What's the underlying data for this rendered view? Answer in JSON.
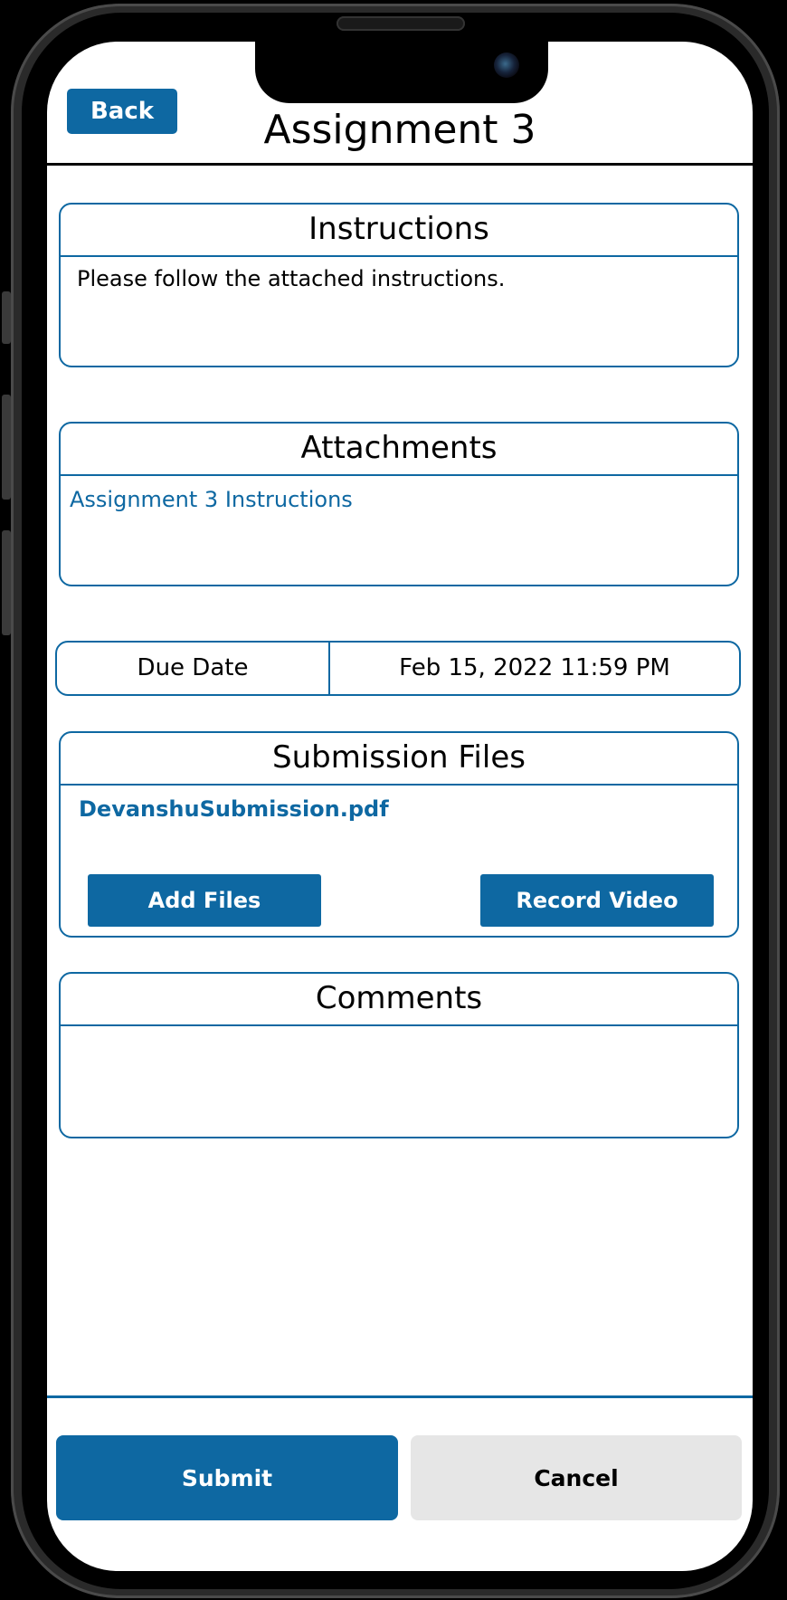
{
  "header": {
    "back_label": "Back",
    "title": "Assignment 3"
  },
  "instructions": {
    "heading": "Instructions",
    "text": "Please follow the attached instructions."
  },
  "attachments": {
    "heading": "Attachments",
    "items": [
      {
        "label": "Assignment 3 Instructions"
      }
    ]
  },
  "due": {
    "label": "Due Date",
    "value": "Feb 15, 2022 11:59 PM"
  },
  "submission": {
    "heading": "Submission Files",
    "files": [
      {
        "name": "DevanshuSubmission.pdf"
      }
    ],
    "add_files_label": "Add Files",
    "record_video_label": "Record Video"
  },
  "comments": {
    "heading": "Comments",
    "value": ""
  },
  "footer": {
    "submit_label": "Submit",
    "cancel_label": "Cancel"
  },
  "colors": {
    "accent": "#0e68a2",
    "cancel_bg": "#e6e6e6"
  }
}
